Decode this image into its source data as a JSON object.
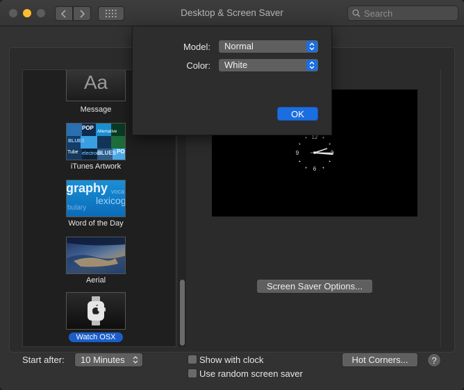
{
  "window": {
    "title": "Desktop & Screen Saver"
  },
  "toolbar": {
    "back_icon": "chevron-left-icon",
    "forward_icon": "chevron-right-icon",
    "grid_icon": "show-all-grid-icon"
  },
  "search": {
    "placeholder": "Search",
    "value": ""
  },
  "modules": [
    {
      "label": "Message",
      "thumb_text": "Aa"
    },
    {
      "label": "iTunes Artwork",
      "tile_labels": [
        "POP",
        "Alternative",
        "BLUES",
        "Tube",
        "electronic",
        "BLUES",
        "POP"
      ]
    },
    {
      "label": "Word of the Day",
      "words": [
        "graphy",
        "voca",
        "lexicog",
        "bulary"
      ]
    },
    {
      "label": "Aerial"
    },
    {
      "label": "Watch OSX",
      "selected": true
    }
  ],
  "preview": {
    "clock_numbers": [
      "12",
      "3",
      "6",
      "9"
    ]
  },
  "buttons": {
    "screen_saver_options": "Screen Saver Options...",
    "hot_corners": "Hot Corners...",
    "help": "?"
  },
  "start_after": {
    "label": "Start after:",
    "value": "10 Minutes"
  },
  "checkboxes": {
    "show_with_clock": "Show with clock",
    "use_random": "Use random screen saver"
  },
  "sheet": {
    "model_label": "Model:",
    "model_value": "Normal",
    "color_label": "Color:",
    "color_value": "White",
    "ok_label": "OK"
  },
  "colors": {
    "accent": "#1b6ee0",
    "selection": "#1b5ec9",
    "minimize": "#febc2e"
  }
}
